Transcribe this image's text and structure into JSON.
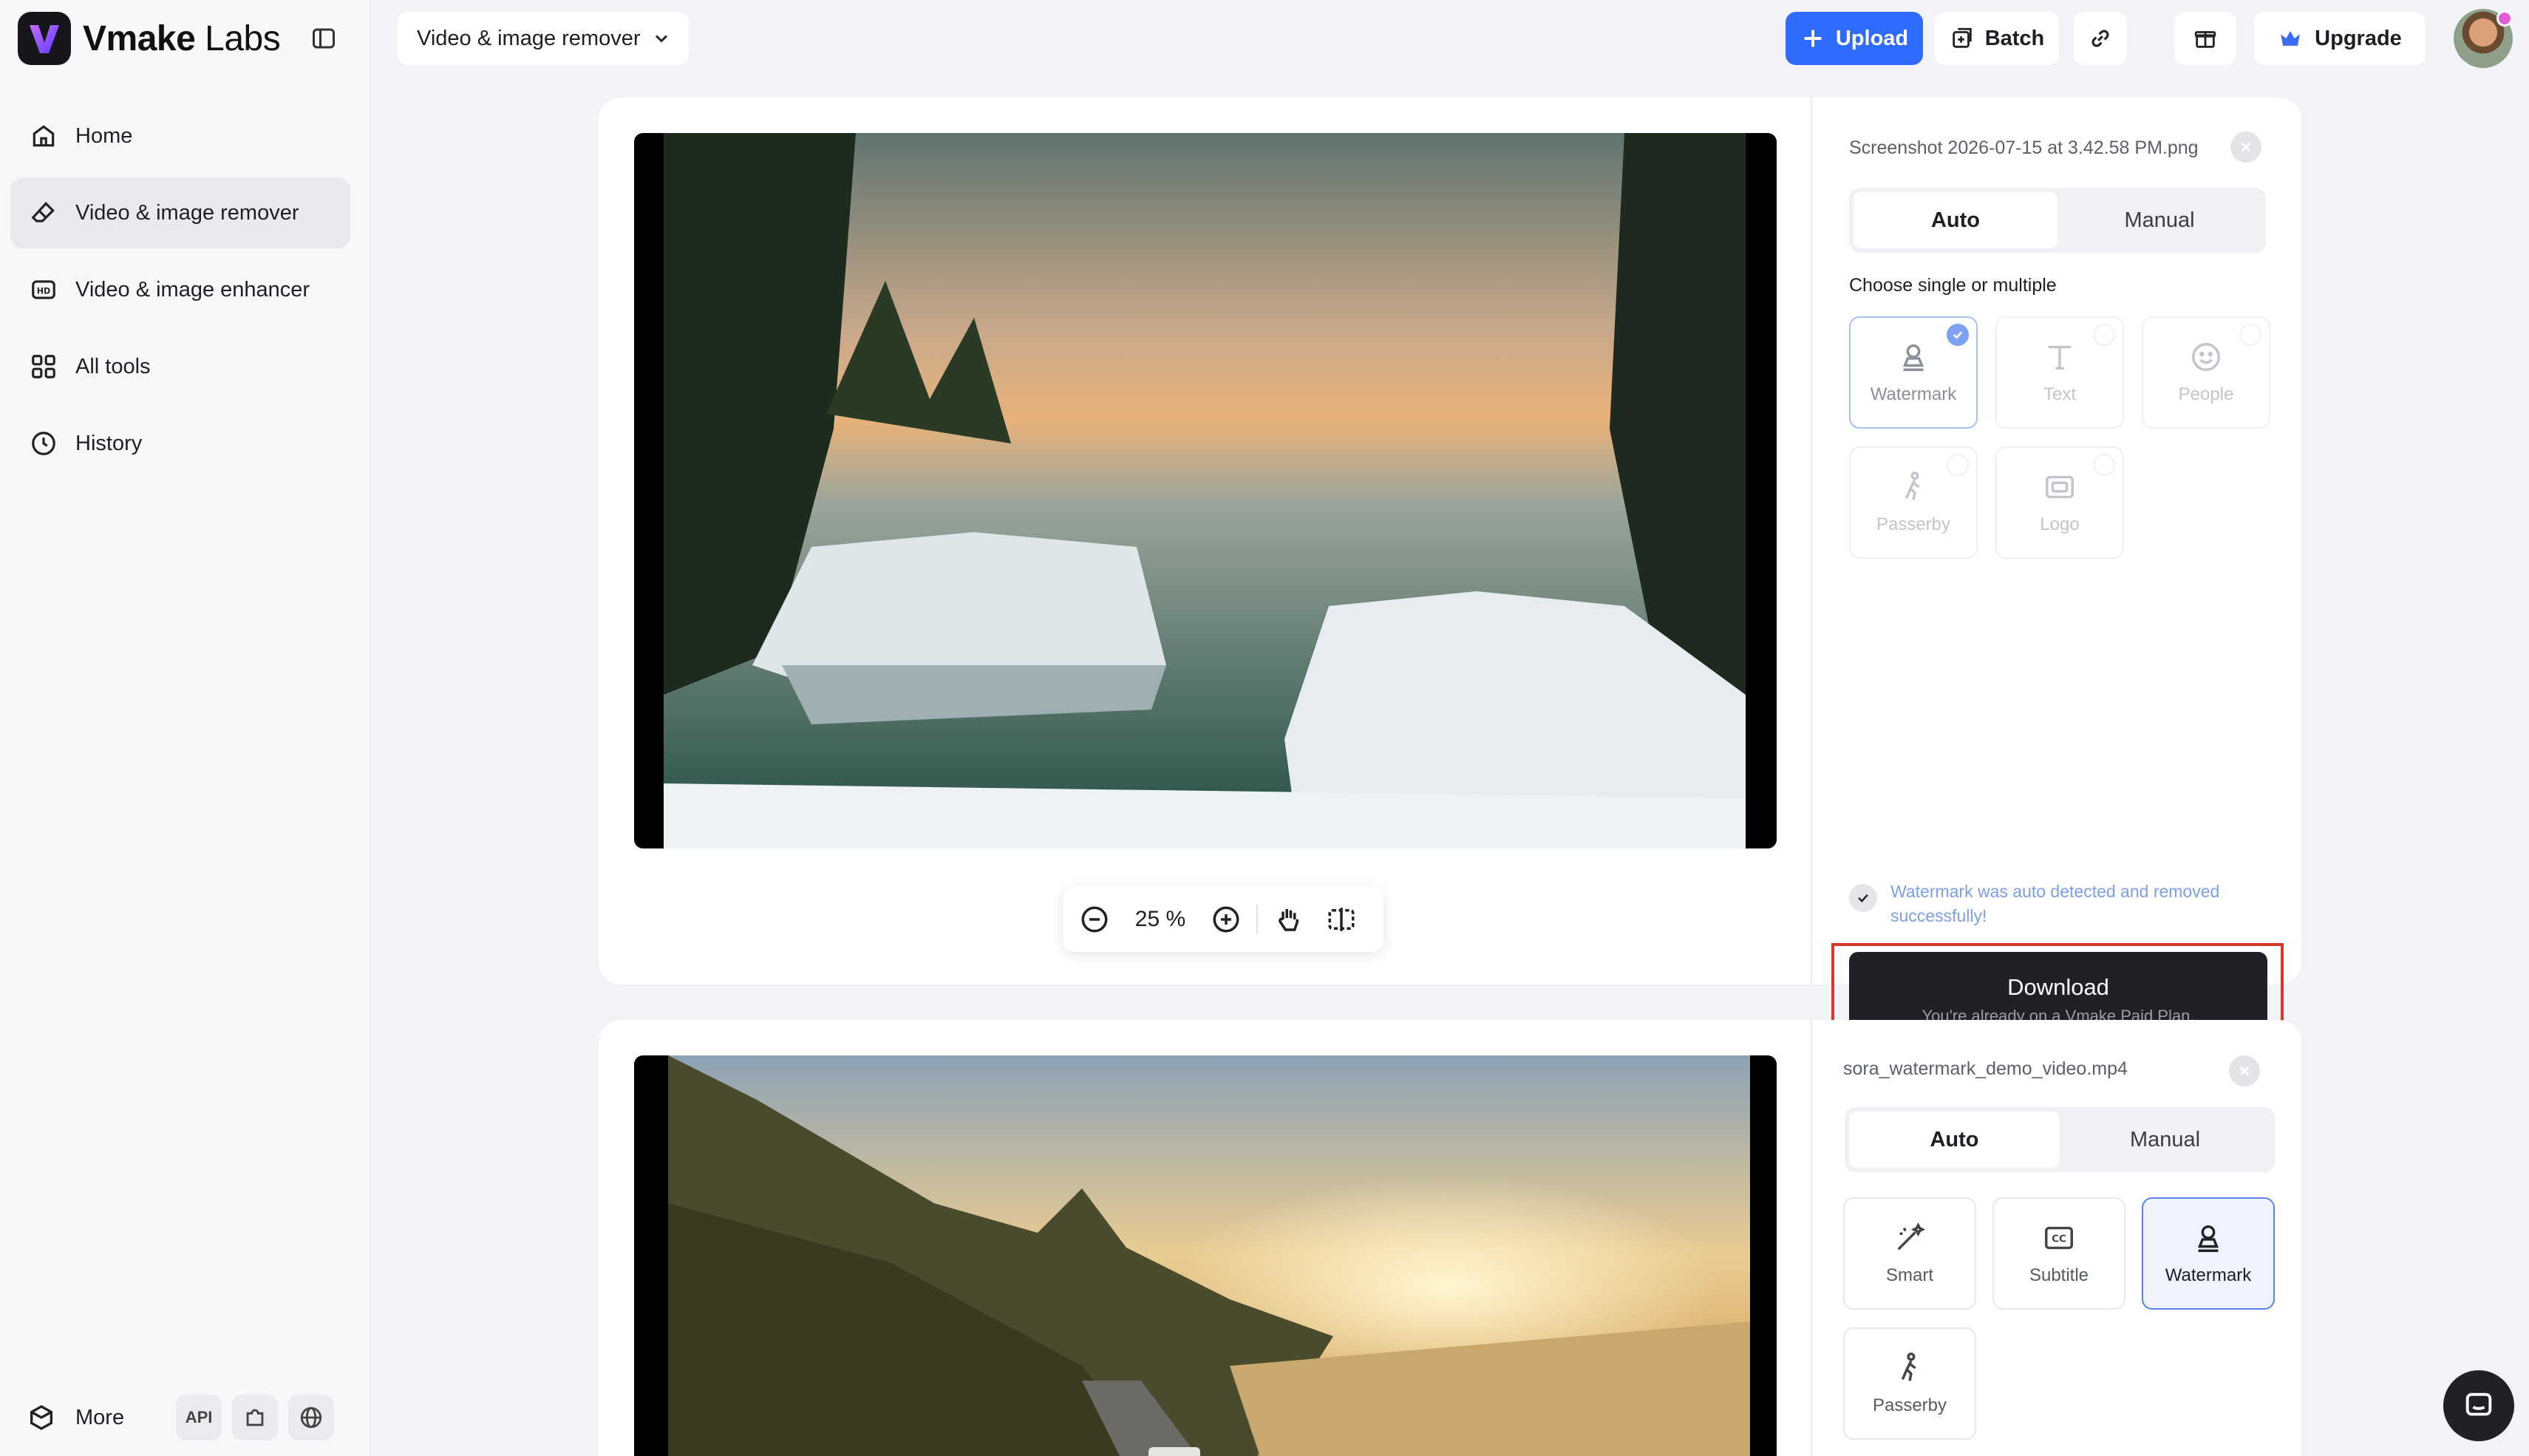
{
  "brand": {
    "name_bold": "Vmake",
    "name_light": " Labs",
    "accent": "#2f6bff"
  },
  "sidebar": {
    "items": [
      {
        "label": "Home",
        "icon": "home-icon"
      },
      {
        "label": "Video & image remover",
        "icon": "eraser-icon",
        "active": true
      },
      {
        "label": "Video & image enhancer",
        "icon": "hd-icon"
      },
      {
        "label": "All tools",
        "icon": "grid-icon"
      },
      {
        "label": "History",
        "icon": "clock-icon"
      }
    ],
    "more_label": "More",
    "api_label": "API"
  },
  "topbar": {
    "tool_select": "Video & image remover",
    "upload_label": "Upload",
    "batch_label": "Batch",
    "upgrade_label": "Upgrade"
  },
  "card1": {
    "file_name": "Screenshot 2026-07-15 at 3.42.58 PM.png",
    "mode_auto": "Auto",
    "mode_manual": "Manual",
    "choose_label": "Choose single or multiple",
    "options": [
      "Watermark",
      "Text",
      "People",
      "Passerby",
      "Logo"
    ],
    "zoom": "25 %",
    "success_text": "Watermark was auto detected and removed successfully!",
    "download_label": "Download",
    "download_sub": "You're already on a Vmake Paid Plan."
  },
  "card2": {
    "file_name": "sora_watermark_demo_video.mp4",
    "mode_auto": "Auto",
    "mode_manual": "Manual",
    "options": [
      "Smart",
      "Subtitle",
      "Watermark",
      "Passerby"
    ]
  }
}
